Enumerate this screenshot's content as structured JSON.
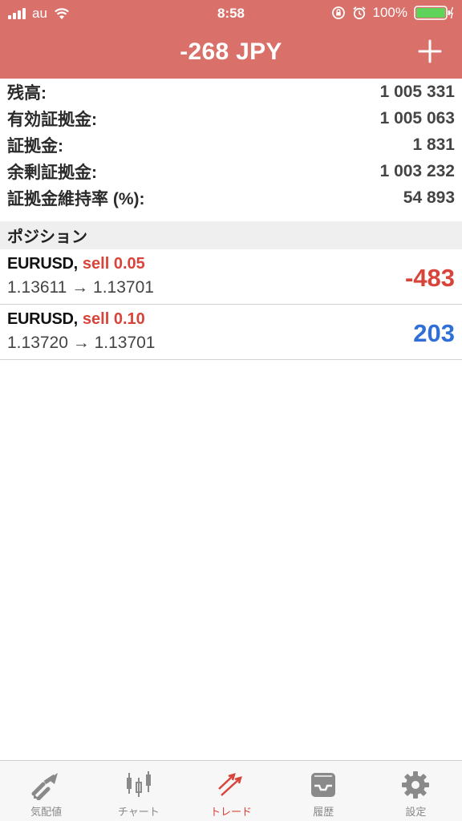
{
  "status_bar": {
    "carrier": "au",
    "time": "8:58",
    "battery": "100%"
  },
  "header": {
    "title": "-268 JPY"
  },
  "summary": [
    {
      "label": "残高:",
      "value": "1 005 331"
    },
    {
      "label": "有効証拠金:",
      "value": "1 005 063"
    },
    {
      "label": "証拠金:",
      "value": "1 831"
    },
    {
      "label": "余剰証拠金:",
      "value": "1 003 232"
    },
    {
      "label": "証拠金維持率 (%):",
      "value": "54 893"
    }
  ],
  "positions_section": {
    "title": "ポジション"
  },
  "positions": [
    {
      "symbol": "EURUSD,",
      "side": "sell 0.05",
      "prices": "1.13611 → 1.13701",
      "profit": "-483",
      "profit_color": "#d9443a"
    },
    {
      "symbol": "EURUSD,",
      "side": "sell 0.10",
      "prices": "1.13720 → 1.13701",
      "profit": "203",
      "profit_color": "#2f6fd6"
    }
  ],
  "tabs": [
    {
      "label": "気配値",
      "icon": "quotes-icon"
    },
    {
      "label": "チャート",
      "icon": "chart-icon"
    },
    {
      "label": "トレード",
      "icon": "trade-icon",
      "active": true
    },
    {
      "label": "履歴",
      "icon": "history-icon"
    },
    {
      "label": "設定",
      "icon": "settings-icon"
    }
  ],
  "colors": {
    "header_bg": "#d9706a",
    "accent_red": "#d9443a",
    "profit_blue": "#2f6fd6",
    "battery_green": "#5fd35a"
  }
}
